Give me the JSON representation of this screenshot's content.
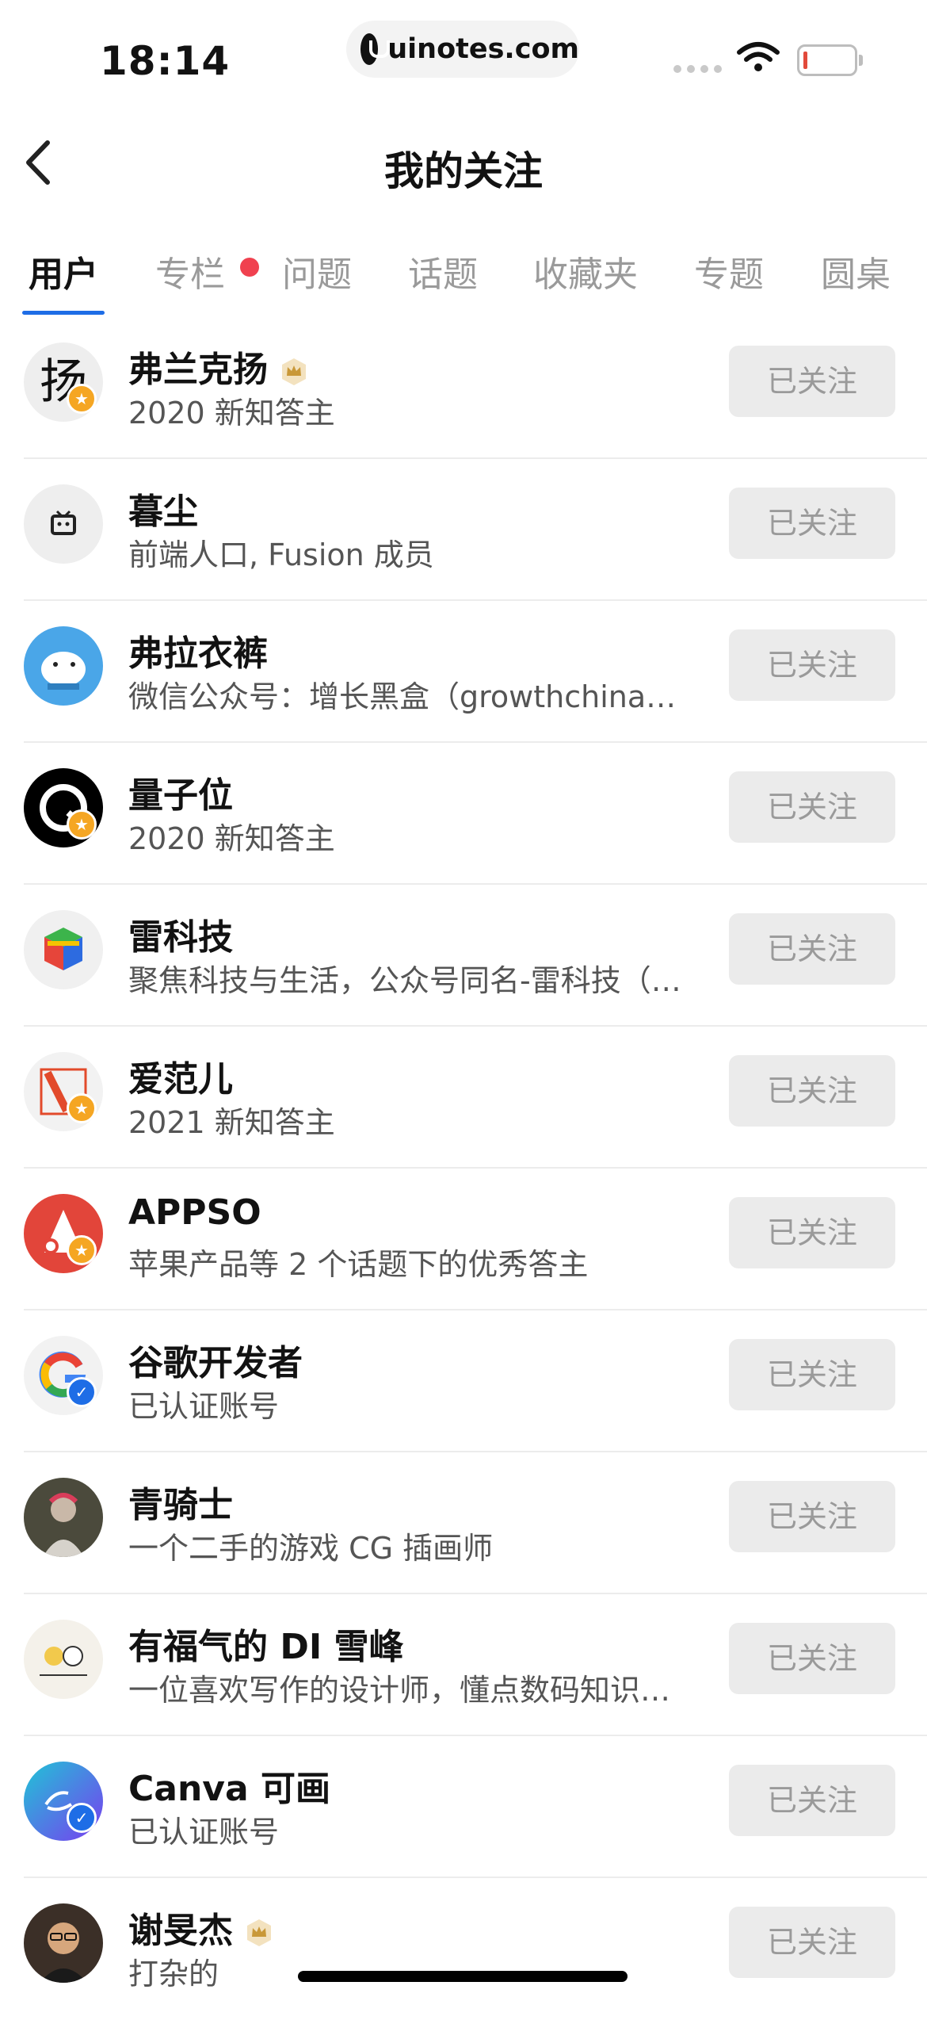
{
  "status": {
    "time": "18:14",
    "url": "uinotes.com"
  },
  "nav": {
    "title": "我的关注"
  },
  "tabs": [
    {
      "label": "用户",
      "active": true
    },
    {
      "label": "专栏",
      "has_dot": true
    },
    {
      "label": "问题"
    },
    {
      "label": "话题"
    },
    {
      "label": "收藏夹"
    },
    {
      "label": "专题"
    },
    {
      "label": "圆桌"
    }
  ],
  "follow_label": "已关注",
  "users": [
    {
      "name": "弗兰克扬",
      "desc": "2020 新知答主",
      "crown": true,
      "badge": "gold",
      "avatar": "calligraphy"
    },
    {
      "name": "暮尘",
      "desc": "前端人口, Fusion 成员",
      "avatar": "tv"
    },
    {
      "name": "弗拉衣裤",
      "desc": "微信公众号：增长黑盒（growthchina…",
      "avatar": "bear"
    },
    {
      "name": "量子位",
      "desc": "2020 新知答主",
      "badge": "gold",
      "avatar": "qbit"
    },
    {
      "name": "雷科技",
      "desc": "聚焦科技与生活，公众号同名-雷科技（…",
      "avatar": "cube"
    },
    {
      "name": "爱范儿",
      "desc": "2021 新知答主",
      "badge": "gold",
      "avatar": "ifanr"
    },
    {
      "name": "APPSO",
      "desc": "苹果产品等 2 个话题下的优秀答主",
      "badge": "gold",
      "avatar": "appso"
    },
    {
      "name": "谷歌开发者",
      "desc": "已认证账号",
      "badge": "blue",
      "avatar": "google"
    },
    {
      "name": "青骑士",
      "desc": "一个二手的游戏 CG 插画师",
      "avatar": "photo"
    },
    {
      "name": "有福气的 DI 雪峰",
      "desc": "一位喜欢写作的设计师，懂点数码知识…",
      "avatar": "drawing"
    },
    {
      "name": "Canva 可画",
      "desc": "已认证账号",
      "badge": "blue",
      "avatar": "canva"
    },
    {
      "name": "谢旻杰",
      "desc": "打杂的",
      "crown": true,
      "avatar": "person"
    }
  ],
  "icons": {
    "back": "chevron-left-icon",
    "crown": "crown-icon",
    "wifi": "wifi-icon",
    "battery": "battery-icon"
  },
  "colors": {
    "accent": "#1e6de6",
    "gold_badge": "#f5a623",
    "dot": "#f0414f"
  }
}
